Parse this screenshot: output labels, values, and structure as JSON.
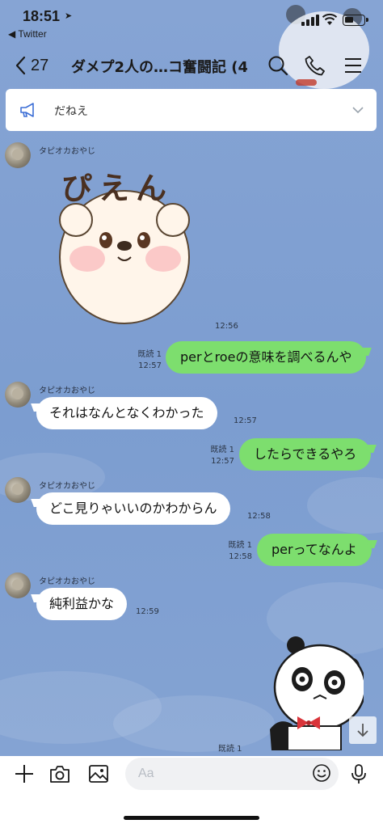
{
  "status_bar": {
    "time": "18:51",
    "back_app": "◀ Twitter"
  },
  "header": {
    "back_icon": "chevron-left-icon",
    "unread_count": "27",
    "title": "ダメプ2人の…コ奮闘記 (4)",
    "icons": [
      "search-icon",
      "phone-icon",
      "menu-icon"
    ]
  },
  "announcement": {
    "icon": "megaphone-icon",
    "text": "だねえ"
  },
  "messages": [
    {
      "id": "m1",
      "direction": "in",
      "sender": "タピオカおやじ",
      "type": "sticker",
      "sticker_name": "bear-pien-sticker",
      "sticker_text": "ぴえん",
      "time": "12:56"
    },
    {
      "id": "m2",
      "direction": "out",
      "text": "perとroeの意味を調べるんや",
      "read": "既読 1",
      "time": "12:57"
    },
    {
      "id": "m3",
      "direction": "in",
      "sender": "タピオカおやじ",
      "text": "それはなんとなくわかった",
      "time": "12:57"
    },
    {
      "id": "m4",
      "direction": "out",
      "text": "したらできるやろ",
      "read": "既読 1",
      "time": "12:57"
    },
    {
      "id": "m5",
      "direction": "in",
      "sender": "タピオカおやじ",
      "text": "どこ見りゃいいのかわからん",
      "time": "12:58"
    },
    {
      "id": "m6",
      "direction": "out",
      "text": "perってなんよ",
      "read": "既読 1",
      "time": "12:58"
    },
    {
      "id": "m7",
      "direction": "in",
      "sender": "タピオカおやじ",
      "text": "純利益かな",
      "time": "12:59"
    },
    {
      "id": "m8",
      "direction": "out",
      "type": "sticker",
      "sticker_name": "panda-sticker",
      "read": "既読 1"
    }
  ],
  "composer": {
    "placeholder": "Aa",
    "icons": [
      "plus-icon",
      "camera-icon",
      "image-icon",
      "emoji-icon",
      "microphone-icon"
    ]
  },
  "colors": {
    "chat_background": "#7f9fd0",
    "outgoing_bubble": "#7dde6e",
    "incoming_bubble": "#ffffff",
    "accent": "#3d6fd6"
  }
}
